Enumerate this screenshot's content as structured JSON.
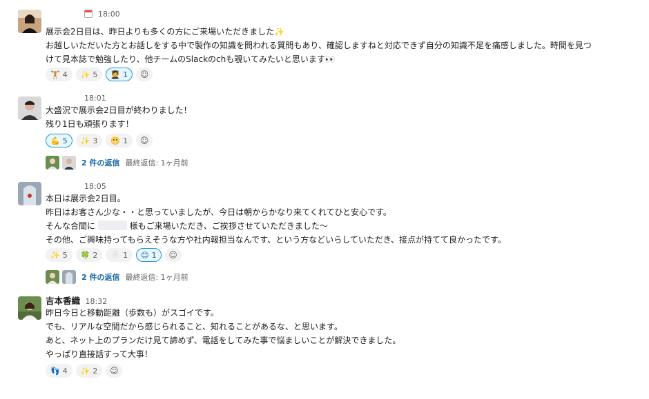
{
  "messages": [
    {
      "name": "",
      "time": "18:00",
      "lines": [
        "展示会2日目は、昨日よりも多くの方にご来場いただきました✨",
        "お越しいただいた方とお話しをする中で製作の知識を問われる質問もあり、確認しますねと対応できず自分の知識不足を痛感しました。時間を見つ",
        "けて見本誌で勉強したり、他チームのSlackのchも覗いてみたいと思います👀"
      ],
      "reactions": [
        {
          "emoji": "🏋",
          "count": "4"
        },
        {
          "emoji": "✨",
          "count": "5"
        },
        {
          "emoji": "🧑‍🎓",
          "count": "1",
          "mine": true
        }
      ]
    },
    {
      "name": "",
      "time": "18:01",
      "lines": [
        "大盛況で展示会2日目が終わりました！",
        "残り1日も頑張ります！"
      ],
      "reactions": [
        {
          "emoji": "💪",
          "count": "5",
          "mine": true
        },
        {
          "emoji": "✨",
          "count": "3"
        },
        {
          "emoji": "😬",
          "count": "1"
        }
      ],
      "thread": {
        "count_label": "2 件の返信",
        "last_reply": "最終返信: 1ヶ月前"
      }
    },
    {
      "name": "",
      "time": "18:05",
      "lines": [
        "本日は展示会2日目。",
        "昨日はお客さん少な・・と思っていましたが、今日は朝からかなり来てくれてひと安心です。",
        "そんな合間に",
        "様もご来場いただき、ご挨拶させていただきました〜",
        "その他、ご興味持ってもらえそうな方や社内報担当なんです、という方などいらしていただき、接点が持てて良かったです。"
      ],
      "reactions": [
        {
          "emoji": "✨",
          "count": "5"
        },
        {
          "emoji": "🍀",
          "count": "2"
        },
        {
          "emoji": "🦷",
          "count": "1"
        },
        {
          "emoji": "😊",
          "count": "1",
          "mine": true
        }
      ],
      "thread": {
        "count_label": "2 件の返信",
        "last_reply": "最終返信: 1ヶ月前"
      }
    },
    {
      "name": "吉本香織",
      "time": "18:32",
      "lines": [
        "昨日今日と移動距離（歩数も）がスゴイです。",
        "でも、リアルな空間だから感じられること、知れることがあるな、と思います。",
        "あと、ネット上のプランだけ見て諦めず、電話をしてみた事で悩ましいことが解決できました。",
        "やっぱり直接話すって大事！"
      ],
      "reactions": [
        {
          "emoji": "👣",
          "count": "4"
        },
        {
          "emoji": "✨",
          "count": "2"
        }
      ]
    }
  ],
  "icons": {
    "add_reaction": "add-reaction-icon",
    "status": "calendar-status-icon"
  },
  "colors": {
    "link": "#1264a3",
    "mine_bg": "#e8f5fa",
    "mine_border": "#1d9bd1",
    "muted": "#616061"
  }
}
